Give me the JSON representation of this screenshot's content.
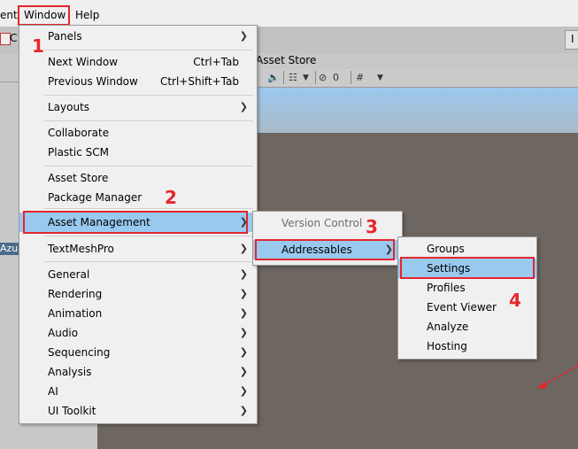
{
  "menubar": {
    "items": [
      {
        "label": "ent"
      },
      {
        "label": "Window"
      },
      {
        "label": "Help"
      }
    ]
  },
  "toolbar": {
    "left_partial": "C",
    "right_button": "I"
  },
  "scene": {
    "tab_label": "Asset Store",
    "left_label": "Azu",
    "hidden_count": "0"
  },
  "window_menu": {
    "items": [
      {
        "label": "Panels",
        "submenu": true
      },
      {
        "label": "Next Window",
        "shortcut": "Ctrl+Tab"
      },
      {
        "label": "Previous Window",
        "shortcut": "Ctrl+Shift+Tab"
      },
      {
        "label": "Layouts",
        "submenu": true
      },
      {
        "label": "Collaborate"
      },
      {
        "label": "Plastic SCM"
      },
      {
        "label": "Asset Store"
      },
      {
        "label": "Package Manager"
      },
      {
        "label": "Asset Management",
        "submenu": true,
        "highlighted": true
      },
      {
        "label": "TextMeshPro",
        "submenu": true
      },
      {
        "label": "General",
        "submenu": true
      },
      {
        "label": "Rendering",
        "submenu": true
      },
      {
        "label": "Animation",
        "submenu": true
      },
      {
        "label": "Audio",
        "submenu": true
      },
      {
        "label": "Sequencing",
        "submenu": true
      },
      {
        "label": "Analysis",
        "submenu": true
      },
      {
        "label": "AI",
        "submenu": true
      },
      {
        "label": "UI Toolkit",
        "submenu": true
      }
    ]
  },
  "asset_management_menu": {
    "items": [
      {
        "label": "Version Control",
        "disabled": true
      },
      {
        "label": "Addressables",
        "submenu": true,
        "highlighted": true
      }
    ]
  },
  "addressables_menu": {
    "items": [
      {
        "label": "Groups"
      },
      {
        "label": "Settings",
        "highlighted": true
      },
      {
        "label": "Profiles"
      },
      {
        "label": "Event Viewer"
      },
      {
        "label": "Analyze"
      },
      {
        "label": "Hosting"
      }
    ]
  },
  "annotations": {
    "step1": "1",
    "step2": "2",
    "step3": "3",
    "step4": "4"
  },
  "colors": {
    "highlight": "#99c9ef",
    "annotation_red": "#e4262d"
  }
}
